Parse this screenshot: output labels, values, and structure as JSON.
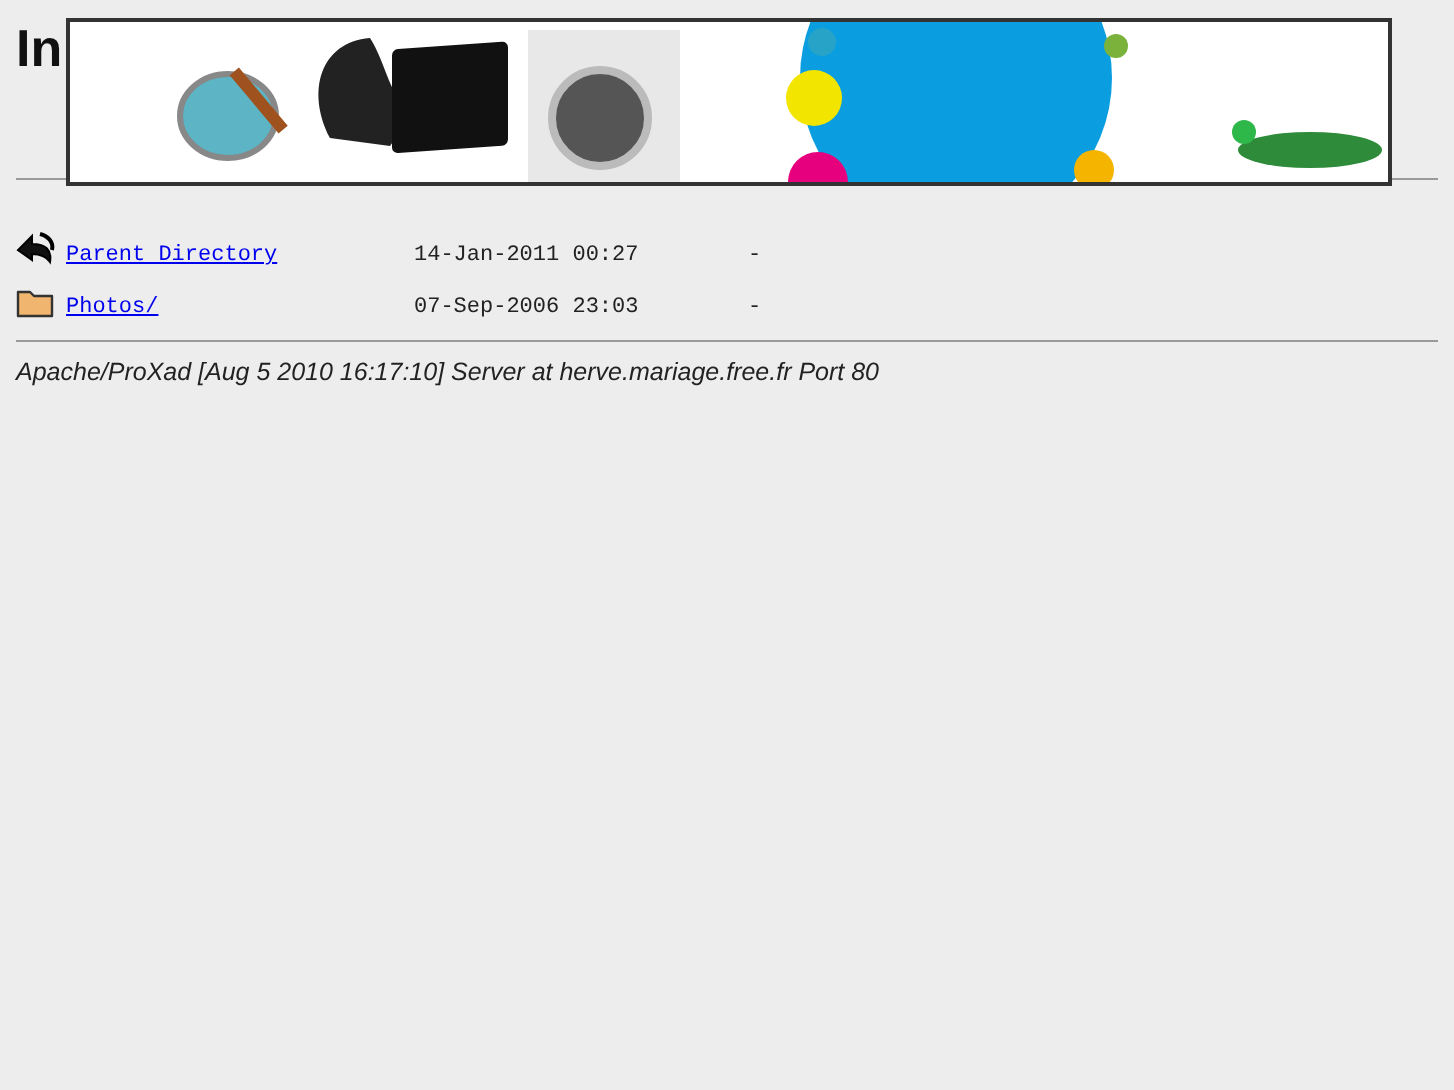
{
  "page": {
    "title": "In"
  },
  "listing": [
    {
      "kind": "parent",
      "name": "Parent Directory",
      "date": "14-Jan-2011 00:27",
      "size": "-"
    },
    {
      "kind": "folder",
      "name": "Photos/",
      "date": "07-Sep-2006 23:03",
      "size": "-"
    }
  ],
  "address": "Apache/ProXad [Aug 5 2010 16:17:10] Server at herve.mariage.free.fr Port 80"
}
